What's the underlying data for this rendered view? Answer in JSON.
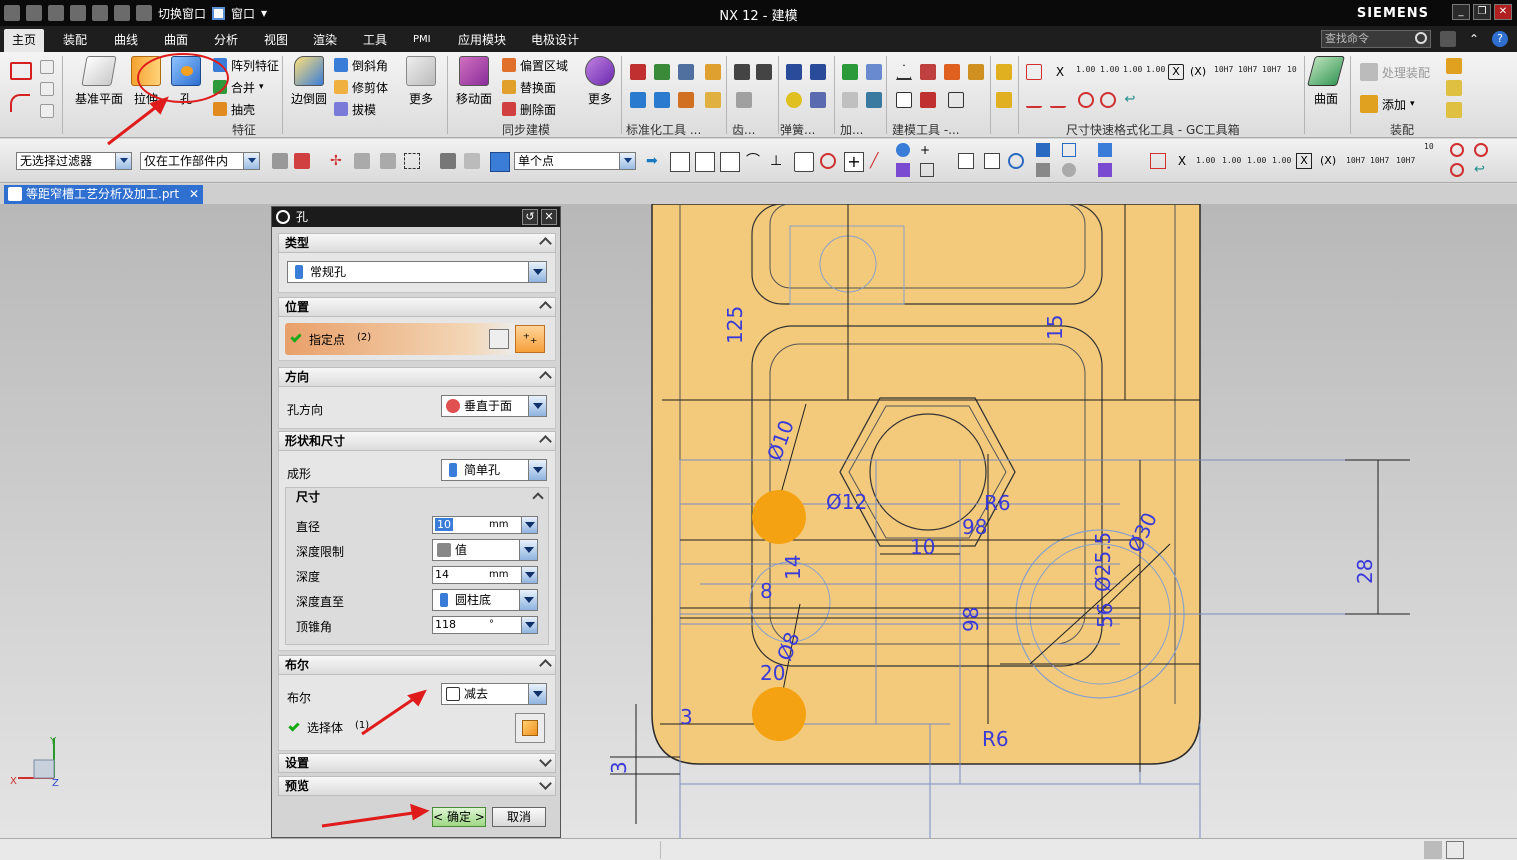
{
  "titlebar": {
    "switch_window": "切换窗口",
    "window_menu": "窗口",
    "title": "NX 12 - 建模",
    "brand": "SIEMENS"
  },
  "tabs": [
    "主页",
    "装配",
    "曲线",
    "曲面",
    "分析",
    "视图",
    "渲染",
    "工具",
    "PMI",
    "应用模块",
    "电极设计"
  ],
  "search_placeholder": "查找命令",
  "ribbon": {
    "datum_plane": "基准平面",
    "extrude": "拉伸",
    "hole": "孔",
    "pattern_feature": "阵列特征",
    "unite": "合并",
    "shell": "抽壳",
    "feature_group": "特征",
    "edge_blend": "边倒圆",
    "chamfer": "倒斜角",
    "trim_body": "修剪体",
    "draft": "拔模",
    "more": "更多",
    "move_face": "移动面",
    "offset_region": "偏置区域",
    "replace_face": "替换面",
    "delete_face": "删除面",
    "more2": "更多",
    "sync_group": "同步建模",
    "std_tools": "标准化工具 ...",
    "gear": "齿...",
    "spring": "弹簧...",
    "machining": "加...",
    "modeling_tools": "建模工具 -...",
    "dim_quick": "尺寸快速格式化工具 - GC工具箱",
    "surface": "曲面",
    "process_assembly": "处理装配",
    "add": "添加",
    "assembly_group": "装配",
    "tol_small": [
      "1.00",
      "1.00",
      "1.00",
      "1.00"
    ],
    "fit_labels": [
      "10H7",
      "10H7",
      "10H7",
      "10"
    ]
  },
  "selbar": {
    "filter": "无选择过滤器",
    "scope": "仅在工作部件内",
    "snap": "单个点"
  },
  "doc_tab": "等距窄槽工艺分析及加工.prt",
  "dialog": {
    "title": "孔",
    "sec_type": "类型",
    "type_value": "常规孔",
    "sec_position": "位置",
    "specify_point": "指定点",
    "point_count": "(2)",
    "sec_direction": "方向",
    "hole_dir_label": "孔方向",
    "hole_dir_value": "垂直于面",
    "sec_form": "形状和尺寸",
    "form_label": "成形",
    "form_value": "简单孔",
    "sub_dim": "尺寸",
    "diameter_label": "直径",
    "diameter_value": "10",
    "diameter_unit": "mm",
    "depth_limit_label": "深度限制",
    "depth_limit_value": "值",
    "depth_label": "深度",
    "depth_value": "14",
    "depth_unit": "mm",
    "depth_to_label": "深度直至",
    "depth_to_value": "圆柱底",
    "tip_angle_label": "顶锥角",
    "tip_angle_value": "118",
    "tip_angle_unit": "°",
    "sec_boolean": "布尔",
    "boolean_label": "布尔",
    "boolean_value": "减去",
    "select_body": "选择体",
    "body_count": "(1)",
    "sec_settings": "设置",
    "sec_preview": "预览",
    "ok": "< 确定 >",
    "cancel": "取消"
  },
  "dimensions": [
    "125",
    "15",
    "Ø10",
    "Ø12",
    "R6",
    "10",
    "98",
    "Ø30",
    "Ø25.5",
    "28",
    "8",
    "14",
    "Ø8",
    "20",
    "98",
    "56",
    "3",
    "3",
    "R6"
  ],
  "triad": {
    "x": "X",
    "y": "Y",
    "z": "Z"
  },
  "colors": {
    "part_fill": "#f3ca7c",
    "hole_marker": "#f5a212",
    "dim_color": "#3a3ad8",
    "annotation_red": "#e01b1b"
  }
}
